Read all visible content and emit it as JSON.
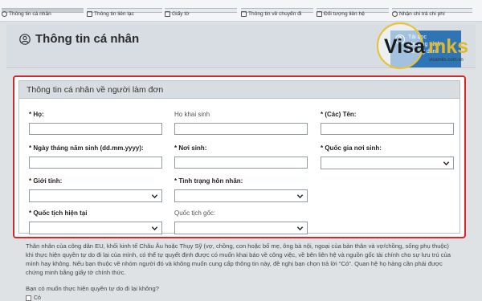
{
  "steps": [
    {
      "label": "Thông tin cá nhân",
      "done": true
    },
    {
      "label": "Thông tin liên lạc",
      "done": false
    },
    {
      "label": "Giấy tờ",
      "done": false
    },
    {
      "label": "Thông tin về chuyến đi",
      "done": false
    },
    {
      "label": "Đối tượng liên hệ",
      "done": false
    },
    {
      "label": "Nhận chi trả chi phí",
      "done": false
    }
  ],
  "header": {
    "title": "Thông tin cá nhân",
    "help_line1": "Tải đọc",
    "help_line2": "chương trình",
    "help_line3": "hướng dẫn"
  },
  "watermark": {
    "text_visa": "Visa",
    "text_mks": "mks",
    "url": "visamks.com.vn"
  },
  "section": {
    "title": "Thông tin cá nhân về người làm đơn"
  },
  "fields": {
    "surname": {
      "label": "* Họ:",
      "value": ""
    },
    "birth_surname": {
      "label": "Họ khai sinh",
      "value": ""
    },
    "given_names": {
      "label": "* (Các) Tên:",
      "value": ""
    },
    "dob": {
      "label": "* Ngày tháng năm sinh (dd.mm.yyyy):",
      "value": ""
    },
    "birth_place": {
      "label": "* Nơi sinh:",
      "value": ""
    },
    "birth_country": {
      "label": "* Quốc gia nơi sinh:",
      "value": ""
    },
    "sex": {
      "label": "* Giới tính:",
      "value": ""
    },
    "marital_status": {
      "label": "* Tình trạng hôn nhân:",
      "value": ""
    },
    "nationality": {
      "label": "* Quốc tịch hiện tại",
      "value": ""
    },
    "original_nationality": {
      "label": "Quốc tịch gốc:",
      "value": ""
    }
  },
  "info_text": "Thân nhân của công dân EU, khối kinh tế Châu Âu hoặc Thụy Sỹ (vợ, chồng, con hoặc bố mẹ, ông bà nội, ngoại của bản thân và vợ/chồng, sống phụ thuộc) khi thực hiện quyền tự do đi lại của mình, có thể tự quyết định được có muốn khai báo về công việc, về bên liên hệ và nguồn gốc tài chính cho sự lưu trú của mình hay không. Nếu bạn thuộc về nhóm người đó và không muốn cung cấp thông tin này, đề nghị bạn chọn trả lời \"Có\". Quan hệ họ hàng cần phải được chứng minh bằng giấy tờ chính thức.",
  "question": "Bạn có muốn thực hiện quyền tự do đi lại không?",
  "radio_yes": "Có"
}
